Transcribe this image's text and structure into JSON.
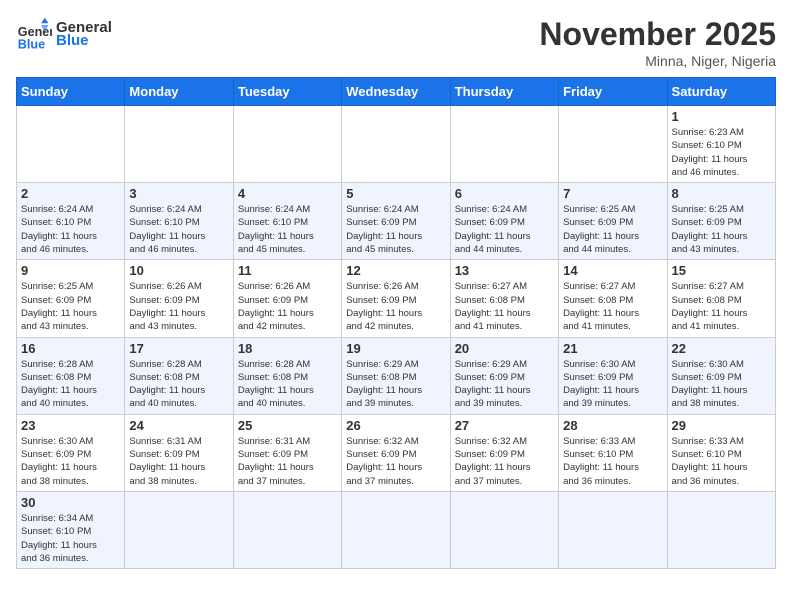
{
  "logo": {
    "text_general": "General",
    "text_blue": "Blue"
  },
  "header": {
    "title": "November 2025",
    "location": "Minna, Niger, Nigeria"
  },
  "weekdays": [
    "Sunday",
    "Monday",
    "Tuesday",
    "Wednesday",
    "Thursday",
    "Friday",
    "Saturday"
  ],
  "weeks": [
    [
      {
        "day": "",
        "info": ""
      },
      {
        "day": "",
        "info": ""
      },
      {
        "day": "",
        "info": ""
      },
      {
        "day": "",
        "info": ""
      },
      {
        "day": "",
        "info": ""
      },
      {
        "day": "",
        "info": ""
      },
      {
        "day": "1",
        "info": "Sunrise: 6:23 AM\nSunset: 6:10 PM\nDaylight: 11 hours\nand 46 minutes."
      }
    ],
    [
      {
        "day": "2",
        "info": "Sunrise: 6:24 AM\nSunset: 6:10 PM\nDaylight: 11 hours\nand 46 minutes."
      },
      {
        "day": "3",
        "info": "Sunrise: 6:24 AM\nSunset: 6:10 PM\nDaylight: 11 hours\nand 46 minutes."
      },
      {
        "day": "4",
        "info": "Sunrise: 6:24 AM\nSunset: 6:10 PM\nDaylight: 11 hours\nand 45 minutes."
      },
      {
        "day": "5",
        "info": "Sunrise: 6:24 AM\nSunset: 6:09 PM\nDaylight: 11 hours\nand 45 minutes."
      },
      {
        "day": "6",
        "info": "Sunrise: 6:24 AM\nSunset: 6:09 PM\nDaylight: 11 hours\nand 44 minutes."
      },
      {
        "day": "7",
        "info": "Sunrise: 6:25 AM\nSunset: 6:09 PM\nDaylight: 11 hours\nand 44 minutes."
      },
      {
        "day": "8",
        "info": "Sunrise: 6:25 AM\nSunset: 6:09 PM\nDaylight: 11 hours\nand 43 minutes."
      }
    ],
    [
      {
        "day": "9",
        "info": "Sunrise: 6:25 AM\nSunset: 6:09 PM\nDaylight: 11 hours\nand 43 minutes."
      },
      {
        "day": "10",
        "info": "Sunrise: 6:26 AM\nSunset: 6:09 PM\nDaylight: 11 hours\nand 43 minutes."
      },
      {
        "day": "11",
        "info": "Sunrise: 6:26 AM\nSunset: 6:09 PM\nDaylight: 11 hours\nand 42 minutes."
      },
      {
        "day": "12",
        "info": "Sunrise: 6:26 AM\nSunset: 6:09 PM\nDaylight: 11 hours\nand 42 minutes."
      },
      {
        "day": "13",
        "info": "Sunrise: 6:27 AM\nSunset: 6:08 PM\nDaylight: 11 hours\nand 41 minutes."
      },
      {
        "day": "14",
        "info": "Sunrise: 6:27 AM\nSunset: 6:08 PM\nDaylight: 11 hours\nand 41 minutes."
      },
      {
        "day": "15",
        "info": "Sunrise: 6:27 AM\nSunset: 6:08 PM\nDaylight: 11 hours\nand 41 minutes."
      }
    ],
    [
      {
        "day": "16",
        "info": "Sunrise: 6:28 AM\nSunset: 6:08 PM\nDaylight: 11 hours\nand 40 minutes."
      },
      {
        "day": "17",
        "info": "Sunrise: 6:28 AM\nSunset: 6:08 PM\nDaylight: 11 hours\nand 40 minutes."
      },
      {
        "day": "18",
        "info": "Sunrise: 6:28 AM\nSunset: 6:08 PM\nDaylight: 11 hours\nand 40 minutes."
      },
      {
        "day": "19",
        "info": "Sunrise: 6:29 AM\nSunset: 6:08 PM\nDaylight: 11 hours\nand 39 minutes."
      },
      {
        "day": "20",
        "info": "Sunrise: 6:29 AM\nSunset: 6:09 PM\nDaylight: 11 hours\nand 39 minutes."
      },
      {
        "day": "21",
        "info": "Sunrise: 6:30 AM\nSunset: 6:09 PM\nDaylight: 11 hours\nand 39 minutes."
      },
      {
        "day": "22",
        "info": "Sunrise: 6:30 AM\nSunset: 6:09 PM\nDaylight: 11 hours\nand 38 minutes."
      }
    ],
    [
      {
        "day": "23",
        "info": "Sunrise: 6:30 AM\nSunset: 6:09 PM\nDaylight: 11 hours\nand 38 minutes."
      },
      {
        "day": "24",
        "info": "Sunrise: 6:31 AM\nSunset: 6:09 PM\nDaylight: 11 hours\nand 38 minutes."
      },
      {
        "day": "25",
        "info": "Sunrise: 6:31 AM\nSunset: 6:09 PM\nDaylight: 11 hours\nand 37 minutes."
      },
      {
        "day": "26",
        "info": "Sunrise: 6:32 AM\nSunset: 6:09 PM\nDaylight: 11 hours\nand 37 minutes."
      },
      {
        "day": "27",
        "info": "Sunrise: 6:32 AM\nSunset: 6:09 PM\nDaylight: 11 hours\nand 37 minutes."
      },
      {
        "day": "28",
        "info": "Sunrise: 6:33 AM\nSunset: 6:10 PM\nDaylight: 11 hours\nand 36 minutes."
      },
      {
        "day": "29",
        "info": "Sunrise: 6:33 AM\nSunset: 6:10 PM\nDaylight: 11 hours\nand 36 minutes."
      }
    ],
    [
      {
        "day": "30",
        "info": "Sunrise: 6:34 AM\nSunset: 6:10 PM\nDaylight: 11 hours\nand 36 minutes."
      },
      {
        "day": "",
        "info": ""
      },
      {
        "day": "",
        "info": ""
      },
      {
        "day": "",
        "info": ""
      },
      {
        "day": "",
        "info": ""
      },
      {
        "day": "",
        "info": ""
      },
      {
        "day": "",
        "info": ""
      }
    ]
  ]
}
